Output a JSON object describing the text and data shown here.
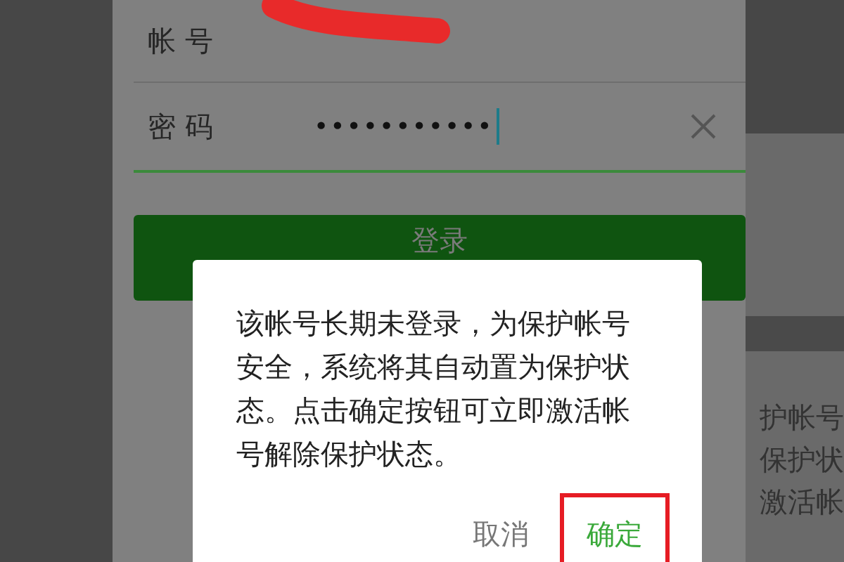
{
  "login_form": {
    "fields": [
      {
        "kind": "account",
        "label": "帐 号",
        "redacted": true
      },
      {
        "kind": "password",
        "label": "密 码",
        "value": "•••••••••••",
        "focused": true
      }
    ],
    "login_button": "登录"
  },
  "background_fragment": {
    "lines": [
      "护帐号",
      "保护状",
      "激活帐"
    ]
  },
  "dialog": {
    "message": "该帐号长期未登录，为保护帐号安全，系统将其自动置为保护状态。点击确定按钮可立即激活帐号解除保护状态。",
    "buttons": [
      {
        "kind": "cancel",
        "label": "取消",
        "highlighted": false
      },
      {
        "kind": "confirm",
        "label": "确定",
        "highlighted": true
      }
    ]
  }
}
